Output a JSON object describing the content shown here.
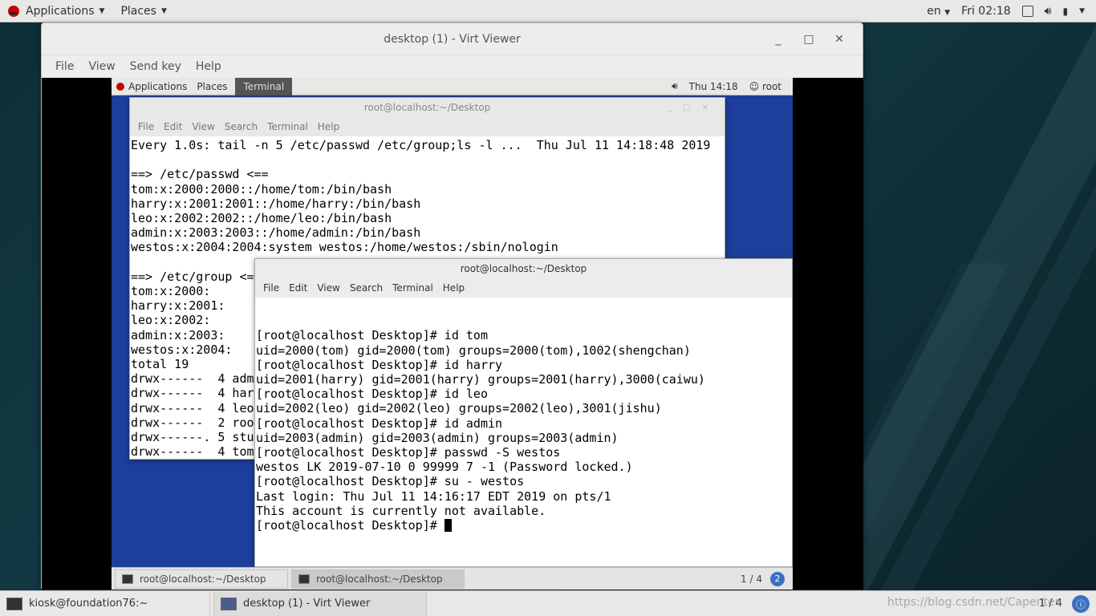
{
  "host_topbar": {
    "applications": "Applications",
    "places": "Places",
    "lang": "en",
    "clock": "Fri 02:18"
  },
  "virt_viewer": {
    "title": "desktop (1) - Virt Viewer",
    "menu": [
      "File",
      "View",
      "Send key",
      "Help"
    ]
  },
  "guest_topbar": {
    "applications": "Applications",
    "places": "Places",
    "terminal": "Terminal",
    "clock": "Thu 14:18",
    "user": "root"
  },
  "term1": {
    "title": "root@localhost:~/Desktop",
    "menu": [
      "File",
      "Edit",
      "View",
      "Search",
      "Terminal",
      "Help"
    ],
    "lines": [
      "Every 1.0s: tail -n 5 /etc/passwd /etc/group;ls -l ...  Thu Jul 11 14:18:48 2019",
      "",
      "==> /etc/passwd <==",
      "tom:x:2000:2000::/home/tom:/bin/bash",
      "harry:x:2001:2001::/home/harry:/bin/bash",
      "leo:x:2002:2002::/home/leo:/bin/bash",
      "admin:x:2003:2003::/home/admin:/bin/bash",
      "westos:x:2004:2004:system westos:/home/westos:/sbin/nologin",
      "",
      "==> /etc/group <==",
      "tom:x:2000:",
      "harry:x:2001:",
      "leo:x:2002:",
      "admin:x:2003:",
      "westos:x:2004:",
      "total 19",
      "drwx------  4 admin",
      "drwx------  4 harry",
      "drwx------  4 leo",
      "drwx------  2 root",
      "drwx------. 5 student",
      "drwx------  4 tom"
    ]
  },
  "term2": {
    "title": "root@localhost:~/Desktop",
    "menu": [
      "File",
      "Edit",
      "View",
      "Search",
      "Terminal",
      "Help"
    ],
    "lines": [
      "[root@localhost Desktop]# id tom",
      "uid=2000(tom) gid=2000(tom) groups=2000(tom),1002(shengchan)",
      "[root@localhost Desktop]# id harry",
      "uid=2001(harry) gid=2001(harry) groups=2001(harry),3000(caiwu)",
      "[root@localhost Desktop]# id leo",
      "uid=2002(leo) gid=2002(leo) groups=2002(leo),3001(jishu)",
      "[root@localhost Desktop]# id admin",
      "uid=2003(admin) gid=2003(admin) groups=2003(admin)",
      "[root@localhost Desktop]# passwd -S westos",
      "westos LK 2019-07-10 0 99999 7 -1 (Password locked.)",
      "[root@localhost Desktop]# su - westos",
      "Last login: Thu Jul 11 14:16:17 EDT 2019 on pts/1",
      "This account is currently not available."
    ],
    "prompt": "[root@localhost Desktop]# "
  },
  "guest_taskbar": {
    "task1": "root@localhost:~/Desktop",
    "task2": "root@localhost:~/Desktop",
    "pager": "1 / 4",
    "badge": "2"
  },
  "host_taskbar": {
    "task1": "kiosk@foundation76:~",
    "task2": "desktop (1) - Virt Viewer",
    "watermark": "https://blog.csdn.net/Capenter",
    "pager": "1 / 4",
    "badge": ""
  }
}
